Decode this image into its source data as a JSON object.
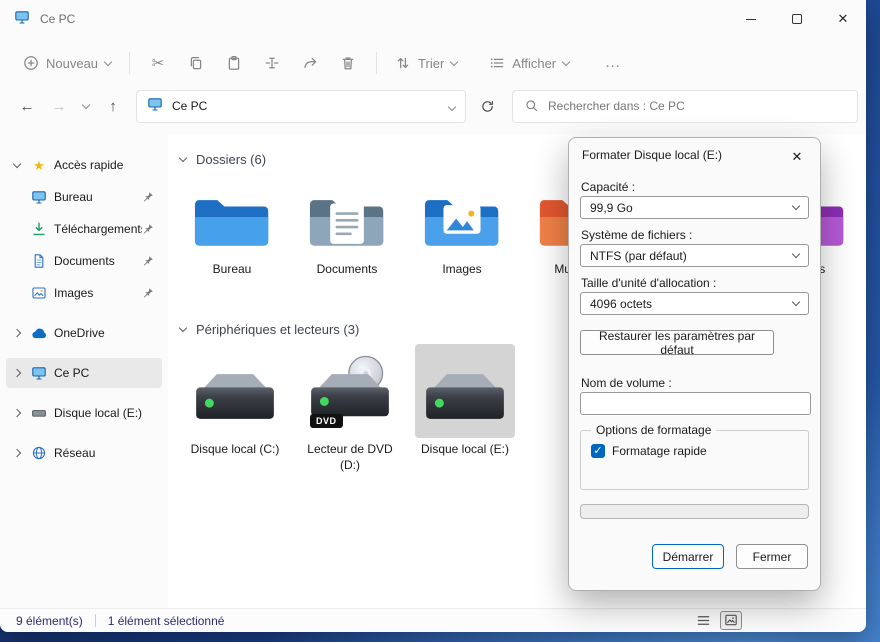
{
  "window": {
    "title": "Ce PC"
  },
  "icons": {
    "close": "✕",
    "back": "←",
    "forward": "→",
    "up": "↑",
    "cut": "✂",
    "more": "…",
    "star": "★",
    "check": "✓"
  },
  "toolbar": {
    "new": "Nouveau",
    "sort": "Trier",
    "view": "Afficher"
  },
  "navbar": {
    "breadcrumb": "Ce PC",
    "search_placeholder": "Rechercher dans : Ce PC"
  },
  "sidebar": {
    "quick_access": "Accès rapide",
    "quick_items": [
      {
        "label": "Bureau"
      },
      {
        "label": "Téléchargements"
      },
      {
        "label": "Documents"
      },
      {
        "label": "Images"
      }
    ],
    "roots": [
      {
        "label": "OneDrive"
      },
      {
        "label": "Ce PC"
      },
      {
        "label": "Disque local (E:)"
      },
      {
        "label": "Réseau"
      }
    ]
  },
  "content": {
    "folders_header": "Dossiers (6)",
    "folders": [
      {
        "label": "Bureau"
      },
      {
        "label": "Documents"
      },
      {
        "label": "Images"
      },
      {
        "label": "Musique"
      },
      {
        "label": "Vidéos"
      }
    ],
    "devices_header": "Périphériques et lecteurs (3)",
    "devices": [
      {
        "label": "Disque local (C:)"
      },
      {
        "label": "Lecteur de DVD (D:)",
        "badge": "DVD"
      },
      {
        "label": "Disque local (E:)"
      }
    ]
  },
  "dialog": {
    "title": "Formater Disque local (E:)",
    "fields": [
      {
        "label": "Capacité :",
        "value": "99,9 Go"
      },
      {
        "label": "Système de fichiers :",
        "value": "NTFS (par défaut)"
      },
      {
        "label": "Taille d'unité d'allocation :",
        "value": "4096 octets"
      }
    ],
    "restore_button": "Restaurer les paramètres par défaut",
    "volume_label": "Nom de volume :",
    "volume_value": "",
    "options_legend": "Options de formatage",
    "quick_format_label": "Formatage rapide",
    "quick_format_checked": true,
    "progress_percent": 0,
    "start_button": "Démarrer",
    "close_button": "Fermer"
  },
  "statusbar": {
    "items_count": "9 élément(s)",
    "selection": "1 élément sélectionné"
  },
  "colors": {
    "accent": "#0067c0",
    "selection_bg": "#d4d4d4",
    "led_green": "#42d95e"
  }
}
